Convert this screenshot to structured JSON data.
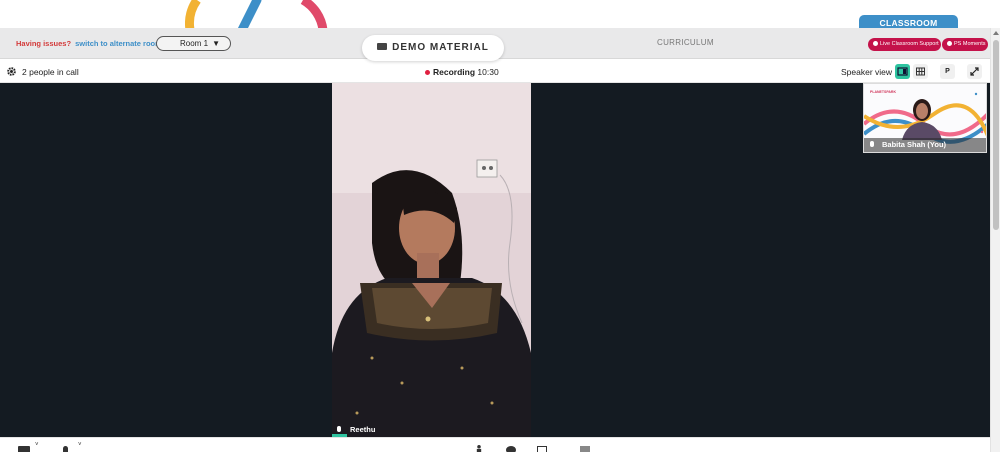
{
  "header": {
    "classroom_tab": "CLASSROOM",
    "issue_text": "Having issues?",
    "alt_room_link": "switch to alternate room",
    "room_select": "Room 1",
    "demo_material": "DEMO MATERIAL",
    "curriculum": "CURRICULUM",
    "live_support": "Live Classroom Support",
    "ps_moments": "PS Moments"
  },
  "call": {
    "people_count": "2 people in call",
    "recording_label": "Recording",
    "recording_time": "10:30",
    "view_mode": "Speaker view",
    "pin_button": "P"
  },
  "participants": {
    "main_name": "Reethu",
    "self_name": "Babita Shah (You)",
    "self_banner": "PLANETSPARK"
  },
  "colors": {
    "accent_teal": "#2ec4a0",
    "brand_red": "#c4124a",
    "brand_blue": "#3d8fc8",
    "stage_bg": "#141b22"
  },
  "icons": [
    "gear-icon",
    "speaker-view-icon",
    "grid-view-icon",
    "fullscreen-icon",
    "mic-icon",
    "camera-icon",
    "chevron-down-icon",
    "person-icon",
    "chat-icon",
    "share-screen-icon",
    "folder-icon"
  ]
}
